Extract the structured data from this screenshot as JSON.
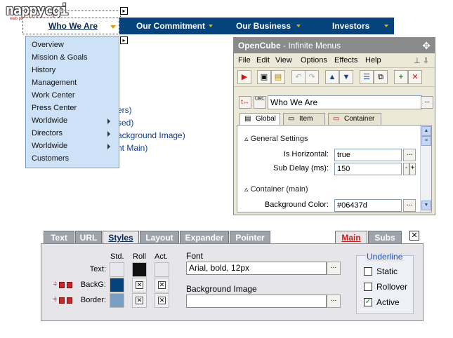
{
  "logo": {
    "text": "nappycgi",
    "tagline": "web programing group"
  },
  "menubar": {
    "items": [
      {
        "label": "Who We Are"
      },
      {
        "label": "Our Commitment"
      },
      {
        "label": "Our Business"
      },
      {
        "label": "Investors"
      }
    ],
    "color": "#06437d",
    "arrow_color": "#e8b000"
  },
  "dropdown": {
    "items": [
      {
        "label": "Overview",
        "has_sub": false
      },
      {
        "label": "Mission & Goals",
        "has_sub": false
      },
      {
        "label": "History",
        "has_sub": false
      },
      {
        "label": "Management",
        "has_sub": false
      },
      {
        "label": "Work Center",
        "has_sub": false
      },
      {
        "label": "Press Center",
        "has_sub": false
      },
      {
        "label": "Worldwide",
        "has_sub": true
      },
      {
        "label": "Directors",
        "has_sub": true
      },
      {
        "label": "Worldwide",
        "has_sub": true
      },
      {
        "label": "Customers",
        "has_sub": false
      }
    ],
    "bg": "#cde1f7"
  },
  "background_links": [
    "ers)",
    "sed)",
    "ackground Image)",
    "nt Main)"
  ],
  "opencube": {
    "title_bold": "OpenCube",
    "title_rest": " - Infinite Menus",
    "menu": [
      "File",
      "Edit",
      "View",
      "Options",
      "Effects",
      "Help"
    ],
    "item_name": "Who We Are",
    "tabs": [
      "Global",
      "Item",
      "Container"
    ],
    "active_tab": "Global",
    "sections": {
      "general": "General Settings",
      "container": "Container (main)"
    },
    "props": {
      "is_horizontal_label": "Is Horizontal:",
      "is_horizontal_value": "true",
      "sub_delay_label": "Sub Delay (ms):",
      "sub_delay_value": "150",
      "bg_color_label": "Background Color:",
      "bg_color_value": "#06437d"
    }
  },
  "styles_panel": {
    "tabs": [
      "Text",
      "URL",
      "Styles",
      "Layout",
      "Expander",
      "Pointer"
    ],
    "active_tab": "Styles",
    "right_tabs": [
      "Main",
      "Subs"
    ],
    "active_right_tab": "Main",
    "columns": [
      "Std.",
      "Roll",
      "Act."
    ],
    "rows": [
      "Text:",
      "BackG:",
      "Border:"
    ],
    "swatches": {
      "text_std": "#e8e8ec",
      "text_roll": "#111111",
      "text_act": "#e8e8ec",
      "backg_std": "#06437d",
      "border_std": "#7b9fc4"
    },
    "font_label": "Font",
    "font_value": "Arial, bold, 12px",
    "bg_image_label": "Background Image",
    "bg_image_value": "",
    "underline_title": "Underline",
    "underline_options": [
      {
        "label": "Static",
        "checked": false
      },
      {
        "label": "Rollover",
        "checked": false
      },
      {
        "label": "Active",
        "checked": true
      }
    ]
  }
}
